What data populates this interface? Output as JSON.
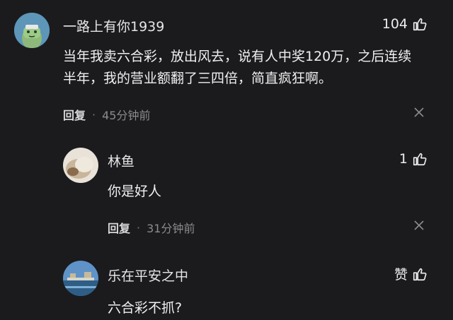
{
  "comments": [
    {
      "username": "一路上有你1939",
      "likes": "104",
      "text": "当年我卖六合彩，放出风去，说有人中奖120万，之后连续半年，我的营业额翻了三四倍，简直疯狂啊。",
      "reply_label": "回复",
      "time": "45分钟前"
    },
    {
      "username": "林鱼",
      "likes": "1",
      "text": "你是好人",
      "reply_label": "回复",
      "time": "31分钟前"
    },
    {
      "username": "乐在平安之中",
      "likes": "赞",
      "text": "六合彩不抓?"
    }
  ],
  "colors": {
    "background": "#1b1b1d",
    "text": "#f0f0f1",
    "meta": "#8b8b90"
  },
  "icons": [
    "thumbs-up-icon",
    "close-icon"
  ]
}
